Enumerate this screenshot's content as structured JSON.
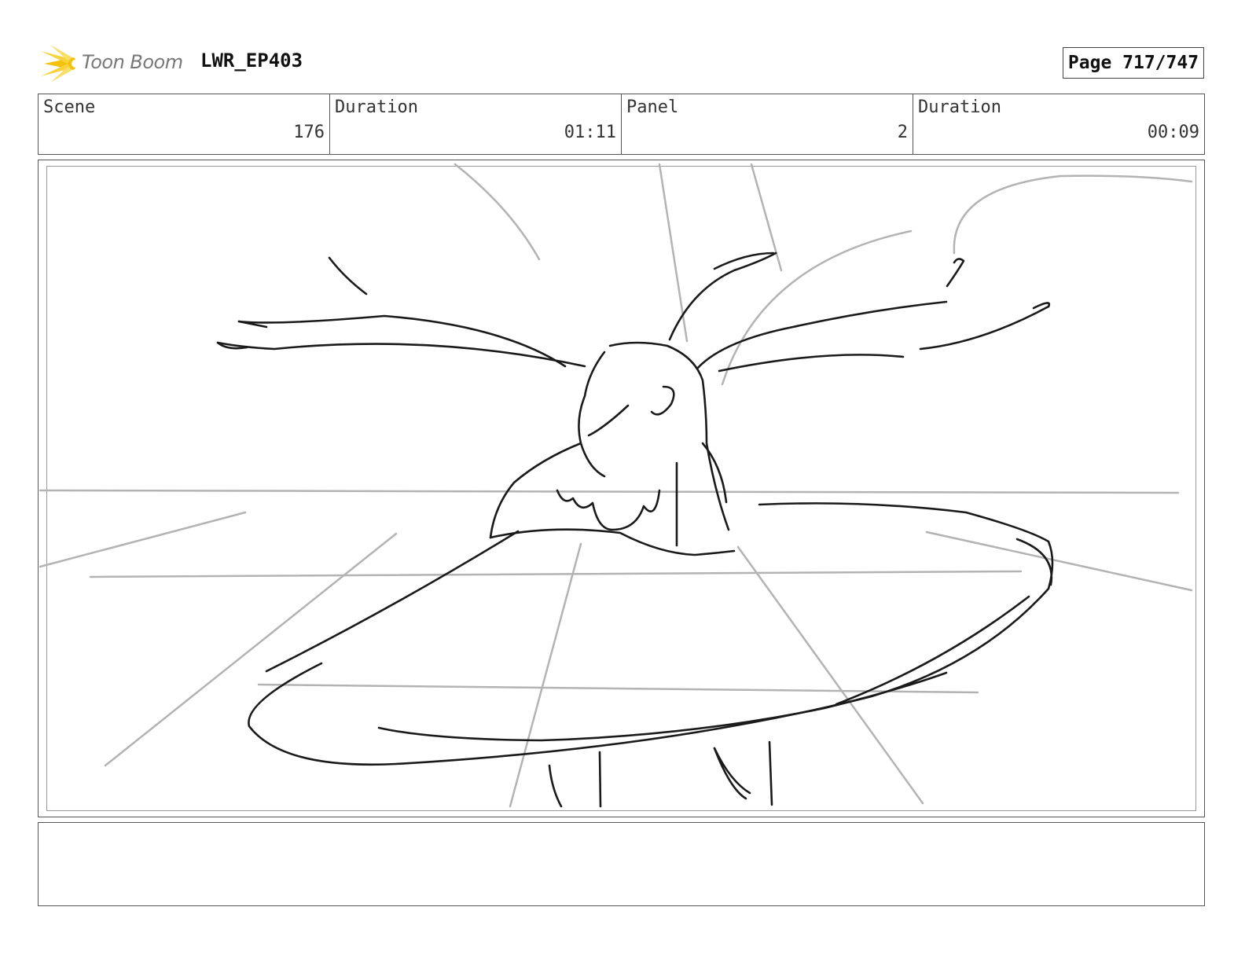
{
  "header": {
    "logo_text": "Toon Boom",
    "project": "LWR_EP403",
    "page": "Page 717/747"
  },
  "info": {
    "scene_label": "Scene",
    "scene_value": "176",
    "scene_duration_label": "Duration",
    "scene_duration_value": "01:11",
    "panel_label": "Panel",
    "panel_value": "2",
    "panel_duration_label": "Duration",
    "panel_duration_value": "00:09"
  },
  "notes": {
    "text": ""
  }
}
